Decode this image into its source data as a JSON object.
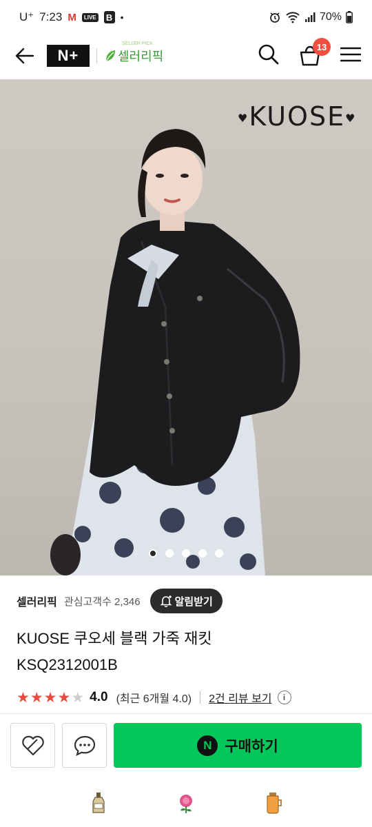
{
  "status_bar": {
    "carrier": "U⁺",
    "time": "7:23",
    "battery": "70%",
    "mail_icon": "M",
    "live_icon": "LIVE",
    "b_icon": "B",
    "dot": "•"
  },
  "header": {
    "nplus_logo": "N+",
    "brand_logo_text": "셀러리픽",
    "brand_logo_tag": "SELLER PICK",
    "cart_count": "13"
  },
  "hero": {
    "brand_logo": "KUOSE",
    "carousel_count": 5,
    "carousel_active": 0
  },
  "product": {
    "shop_name": "셀러리픽",
    "fans_label": "관심고객수 2,346",
    "alert_button": "알림받기",
    "title_line1": "KUOSE 쿠오세 블랙 가죽 재킷",
    "title_line2": "KSQ2312001B",
    "rating_value": "4.0",
    "rating_stars": 4,
    "rating_recent": "(최근 6개월 4.0)",
    "review_link": "2건 리뷰 보기",
    "info_icon": "i"
  },
  "actions": {
    "buy_label": "구매하기",
    "npay_badge": "N"
  },
  "colors": {
    "buy_green": "#03c75a",
    "badge_red": "#f04e3e",
    "star_red": "#e84b3c"
  }
}
